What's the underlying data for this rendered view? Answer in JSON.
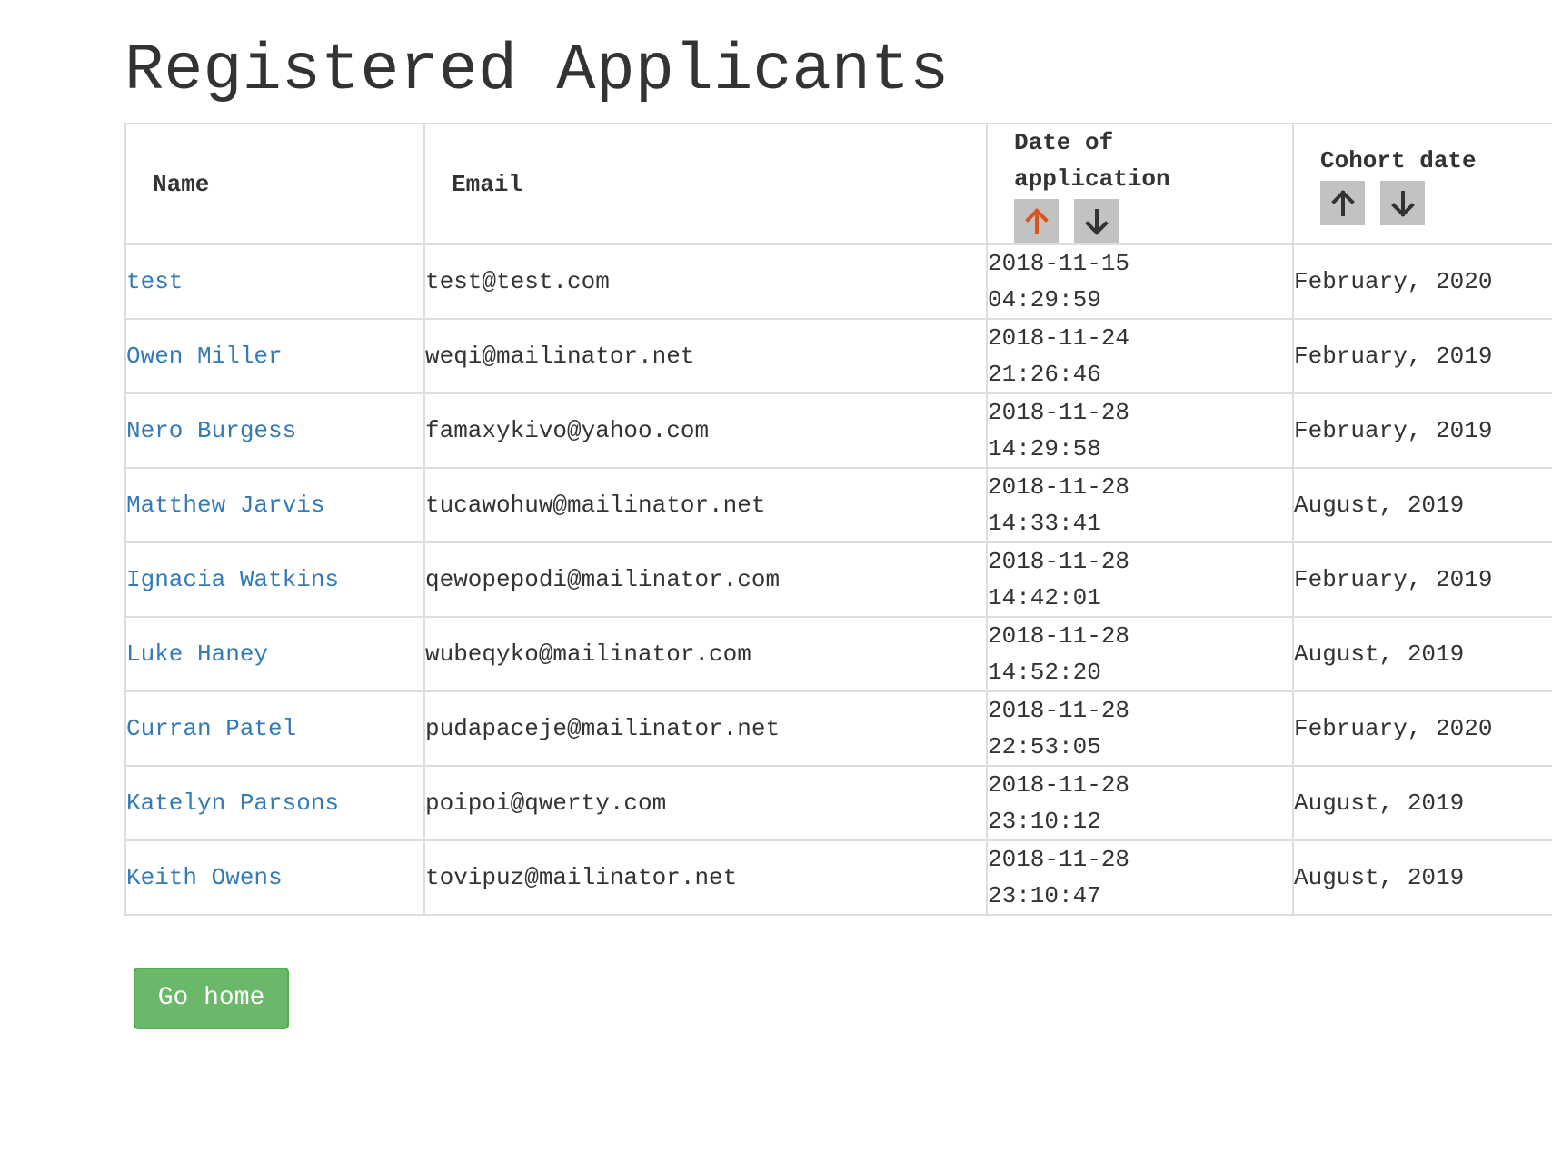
{
  "page": {
    "title": "Registered Applicants"
  },
  "table": {
    "headers": {
      "name": "Name",
      "email": "Email",
      "date_of_application": "Date of application",
      "cohort_date": "Cohort date"
    },
    "sort": {
      "date_of_application": {
        "active": "ascending",
        "active_color": "#d9541e",
        "inactive_color": "#333333"
      },
      "cohort_date": {
        "active": "none"
      },
      "up_icon": "arrow-up-icon",
      "down_icon": "arrow-down-icon"
    },
    "rows": [
      {
        "name": "test",
        "email": "test@test.com",
        "date": "2018-11-15",
        "time": "04:29:59",
        "cohort": "February, 2020"
      },
      {
        "name": "Owen Miller",
        "email": "weqi@mailinator.net",
        "date": "2018-11-24",
        "time": "21:26:46",
        "cohort": "February, 2019"
      },
      {
        "name": "Nero Burgess",
        "email": "famaxykivo@yahoo.com",
        "date": "2018-11-28",
        "time": "14:29:58",
        "cohort": "February, 2019"
      },
      {
        "name": "Matthew Jarvis",
        "email": "tucawohuw@mailinator.net",
        "date": "2018-11-28",
        "time": "14:33:41",
        "cohort": "August, 2019"
      },
      {
        "name": "Ignacia Watkins",
        "email": "qewopepodi@mailinator.com",
        "date": "2018-11-28",
        "time": "14:42:01",
        "cohort": "February, 2019"
      },
      {
        "name": "Luke Haney",
        "email": "wubeqyko@mailinator.com",
        "date": "2018-11-28",
        "time": "14:52:20",
        "cohort": "August, 2019"
      },
      {
        "name": "Curran Patel",
        "email": "pudapaceje@mailinator.net",
        "date": "2018-11-28",
        "time": "22:53:05",
        "cohort": "February, 2020"
      },
      {
        "name": "Katelyn Parsons",
        "email": "poipoi@qwerty.com",
        "date": "2018-11-28",
        "time": "23:10:12",
        "cohort": "August, 2019"
      },
      {
        "name": "Keith Owens",
        "email": "tovipuz@mailinator.net",
        "date": "2018-11-28",
        "time": "23:10:47",
        "cohort": "August, 2019"
      }
    ]
  },
  "actions": {
    "go_home_label": "Go home",
    "go_home_color": "#6bb86a"
  },
  "colors": {
    "link": "#337ab7",
    "text": "#333333",
    "border": "#dddddd",
    "sort_button_bg": "#c2c2c2"
  }
}
